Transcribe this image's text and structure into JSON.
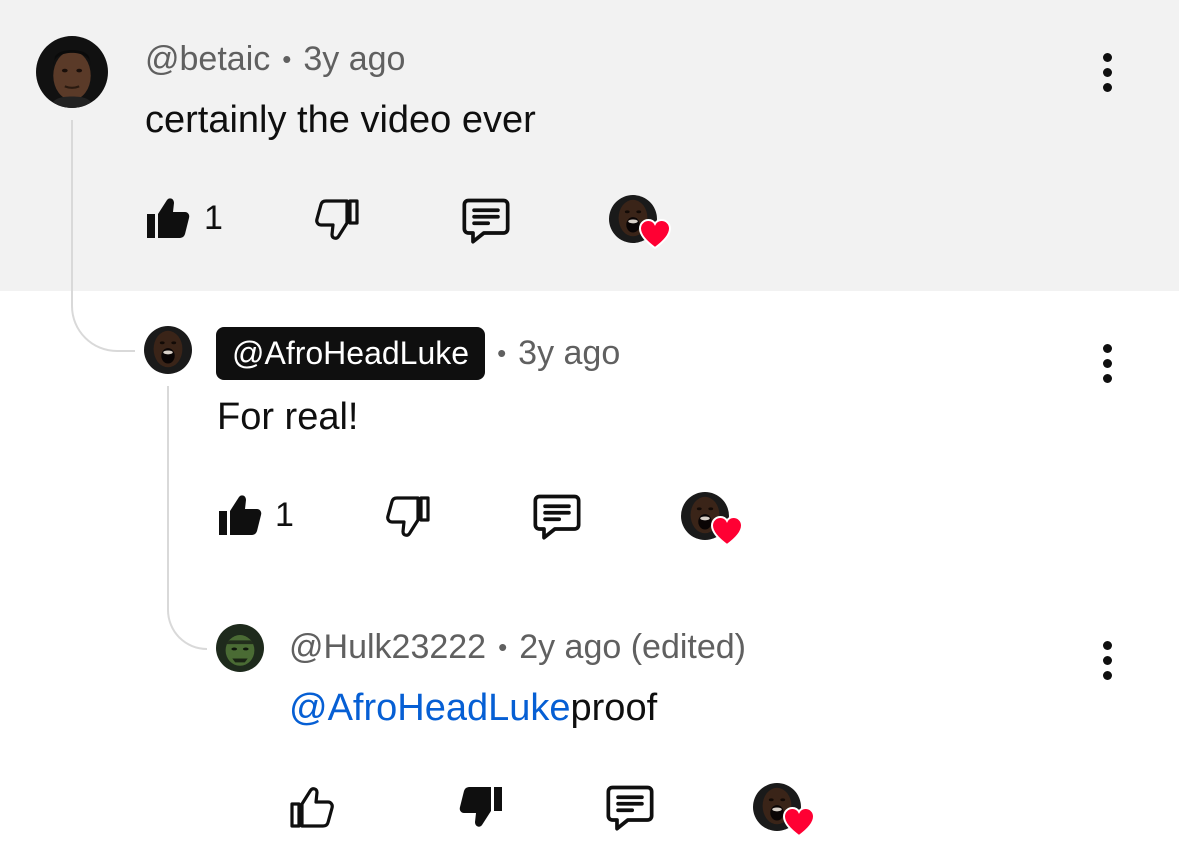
{
  "comments": [
    {
      "handle": "@betaic",
      "time": "3y ago",
      "text": "certainly the video ever",
      "likes": "1"
    },
    {
      "handle": "@AfroHeadLuke",
      "time": "3y ago",
      "text": "For real!",
      "likes": "1"
    },
    {
      "handle": "@Hulk23222",
      "time": "2y ago (edited)",
      "mention": "@AfroHeadLuke",
      "text": "proof"
    }
  ],
  "icons": {
    "like": "thumbs-up-icon",
    "dislike": "thumbs-down-icon",
    "reply": "reply-icon",
    "heart": "heart-icon",
    "more": "more-vert-icon"
  },
  "colors": {
    "highlight_bg": "#f2f2f2",
    "mention": "#065fd4",
    "heart": "#ff0033",
    "badge_bg": "#0f0f0f"
  },
  "dot_separator": "•"
}
